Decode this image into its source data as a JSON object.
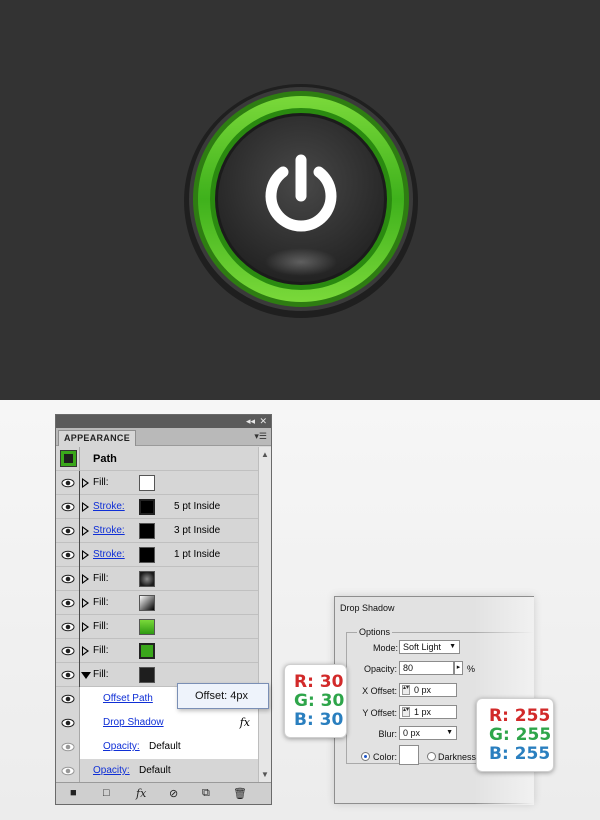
{
  "appearance_panel": {
    "tab_label": "APPEARANCE",
    "collapse_icon": "double-arrow-left-icon",
    "close_icon": "close-icon",
    "menu_icon": "panel-menu-icon",
    "object_label": "Path",
    "rows": [
      {
        "label": "Fill:",
        "type": "fill",
        "swatch": "#ffffff",
        "info": ""
      },
      {
        "label": "Stroke:",
        "type": "stroke",
        "swatch": "#000000",
        "info": "5 pt  Inside"
      },
      {
        "label": "Stroke:",
        "type": "stroke",
        "swatch": "#000000",
        "info": "3 pt  Inside"
      },
      {
        "label": "Stroke:",
        "type": "stroke",
        "swatch": "#000000",
        "info": "1 pt  Inside"
      },
      {
        "label": "Fill:",
        "type": "fill",
        "swatch": "radial-dark",
        "info": ""
      },
      {
        "label": "Fill:",
        "type": "fill",
        "swatch": "linear-white-black",
        "info": ""
      },
      {
        "label": "Fill:",
        "type": "fill",
        "swatch": "linear-green",
        "info": ""
      },
      {
        "label": "Fill:",
        "type": "fill",
        "swatch": "#3aa71b",
        "info": ""
      },
      {
        "label": "Fill:",
        "type": "fill",
        "swatch": "#1e1e1e",
        "info": ""
      }
    ],
    "effects": {
      "offset_path": "Offset Path",
      "drop_shadow": "Drop Shadow",
      "fx_label": "fx",
      "opacity_label": "Opacity:",
      "opacity_value": "Default"
    },
    "footer_opacity_label": "Opacity:",
    "footer_opacity_value": "Default",
    "tooltip": "Offset: 4px",
    "bottom_icons": [
      "new-art-basic-icon",
      "clear-appearance-icon",
      "fx-icon",
      "no-icon",
      "duplicate-icon",
      "trash-icon"
    ]
  },
  "drop_shadow_dialog": {
    "title": "Drop Shadow",
    "group_label": "Options",
    "mode_label": "Mode:",
    "mode_value": "Soft Light",
    "opacity_label": "Opacity:",
    "opacity_value": "80",
    "opacity_unit": "%",
    "x_offset_label": "X Offset:",
    "x_offset_value": "0 px",
    "y_offset_label": "Y Offset:",
    "y_offset_value": "1 px",
    "blur_label": "Blur:",
    "blur_value": "0 px",
    "color_label": "Color:",
    "darkness_label": "Darkness:"
  },
  "callouts": {
    "dark": {
      "r": "R: 30",
      "g": "G: 30",
      "b": "B: 30"
    },
    "white": {
      "r": "R: 255",
      "g": "G: 255",
      "b": "B: 255"
    }
  },
  "colors": {
    "background": "#333333",
    "button_green": "#4fbf1f",
    "button_face": "#2b2b2b",
    "power_icon": "#ffffff"
  }
}
